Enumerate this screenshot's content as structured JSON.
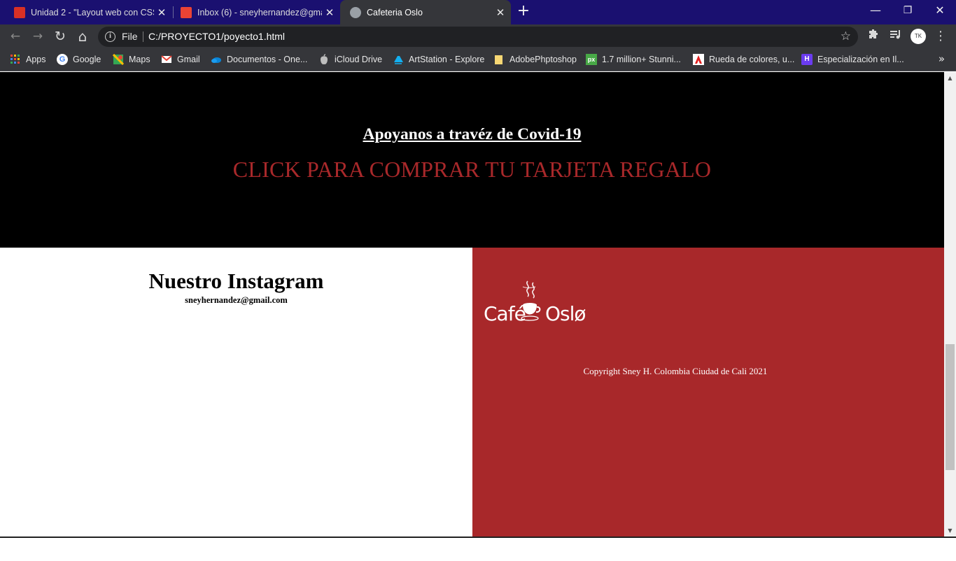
{
  "tabs": [
    {
      "title": "Unidad 2 - \"Layout web con CSS",
      "icon": "gmail-red-icon",
      "color": "#d93025",
      "active": false
    },
    {
      "title": "Inbox (6) - sneyhernandez@gmai",
      "icon": "gmail-icon",
      "color": "#ea4335",
      "active": false
    },
    {
      "title": "Cafeteria Oslo",
      "icon": "globe-icon",
      "color": "#9aa0a6",
      "active": true
    }
  ],
  "window_controls": {
    "minimize": "—",
    "restore": "❐",
    "close": "✕"
  },
  "toolbar": {
    "back": "←",
    "forward": "→",
    "reload": "↻",
    "home": "⌂",
    "scheme": "File",
    "url": "C:/PROYECTO1/poyecto1.html",
    "avatar": "TK"
  },
  "bookmarks": [
    {
      "label": "Apps",
      "icon": "apps-grid-icon",
      "color": "#4285f4"
    },
    {
      "label": "Google",
      "icon": "google-icon",
      "color": "#4285f4"
    },
    {
      "label": "Maps",
      "icon": "maps-icon",
      "color": "#34a853"
    },
    {
      "label": "Gmail",
      "icon": "gmail-icon",
      "color": "#ea4335"
    },
    {
      "label": "Documentos - One...",
      "icon": "onedrive-icon",
      "color": "#0a84d6"
    },
    {
      "label": "iCloud Drive",
      "icon": "apple-icon",
      "color": "#bdbdbd"
    },
    {
      "label": "ArtStation - Explore",
      "icon": "artstation-icon",
      "color": "#13aff0"
    },
    {
      "label": "AdobePhptoshop",
      "icon": "folder-icon",
      "color": "#f7d774"
    },
    {
      "label": "1.7 million+ Stunni...",
      "icon": "pixabay-icon",
      "color": "#48a947"
    },
    {
      "label": "Rueda de colores, u...",
      "icon": "adobe-icon",
      "color": "#e22020"
    },
    {
      "label": "Especialización en Il...",
      "icon": "course-icon",
      "color": "#6b3cf0"
    }
  ],
  "page": {
    "hero_title": "Apoyanos a travéz de Covid-19",
    "hero_cta": "CLICK PARA COMPRAR TU TARJETA REGALO",
    "instagram_title": "Nuestro Instagram",
    "instagram_email": "sneyhernandez@gmail.com",
    "logo_text_left": "Café",
    "logo_text_right": "Oslø",
    "copyright": "Copyright Sney H. Colombia Ciudad de Cali 2021"
  },
  "colors": {
    "titlebar": "#1a1070",
    "toolbar": "#35363a",
    "brand_red": "#a8282a",
    "hero_bg": "#000000"
  }
}
